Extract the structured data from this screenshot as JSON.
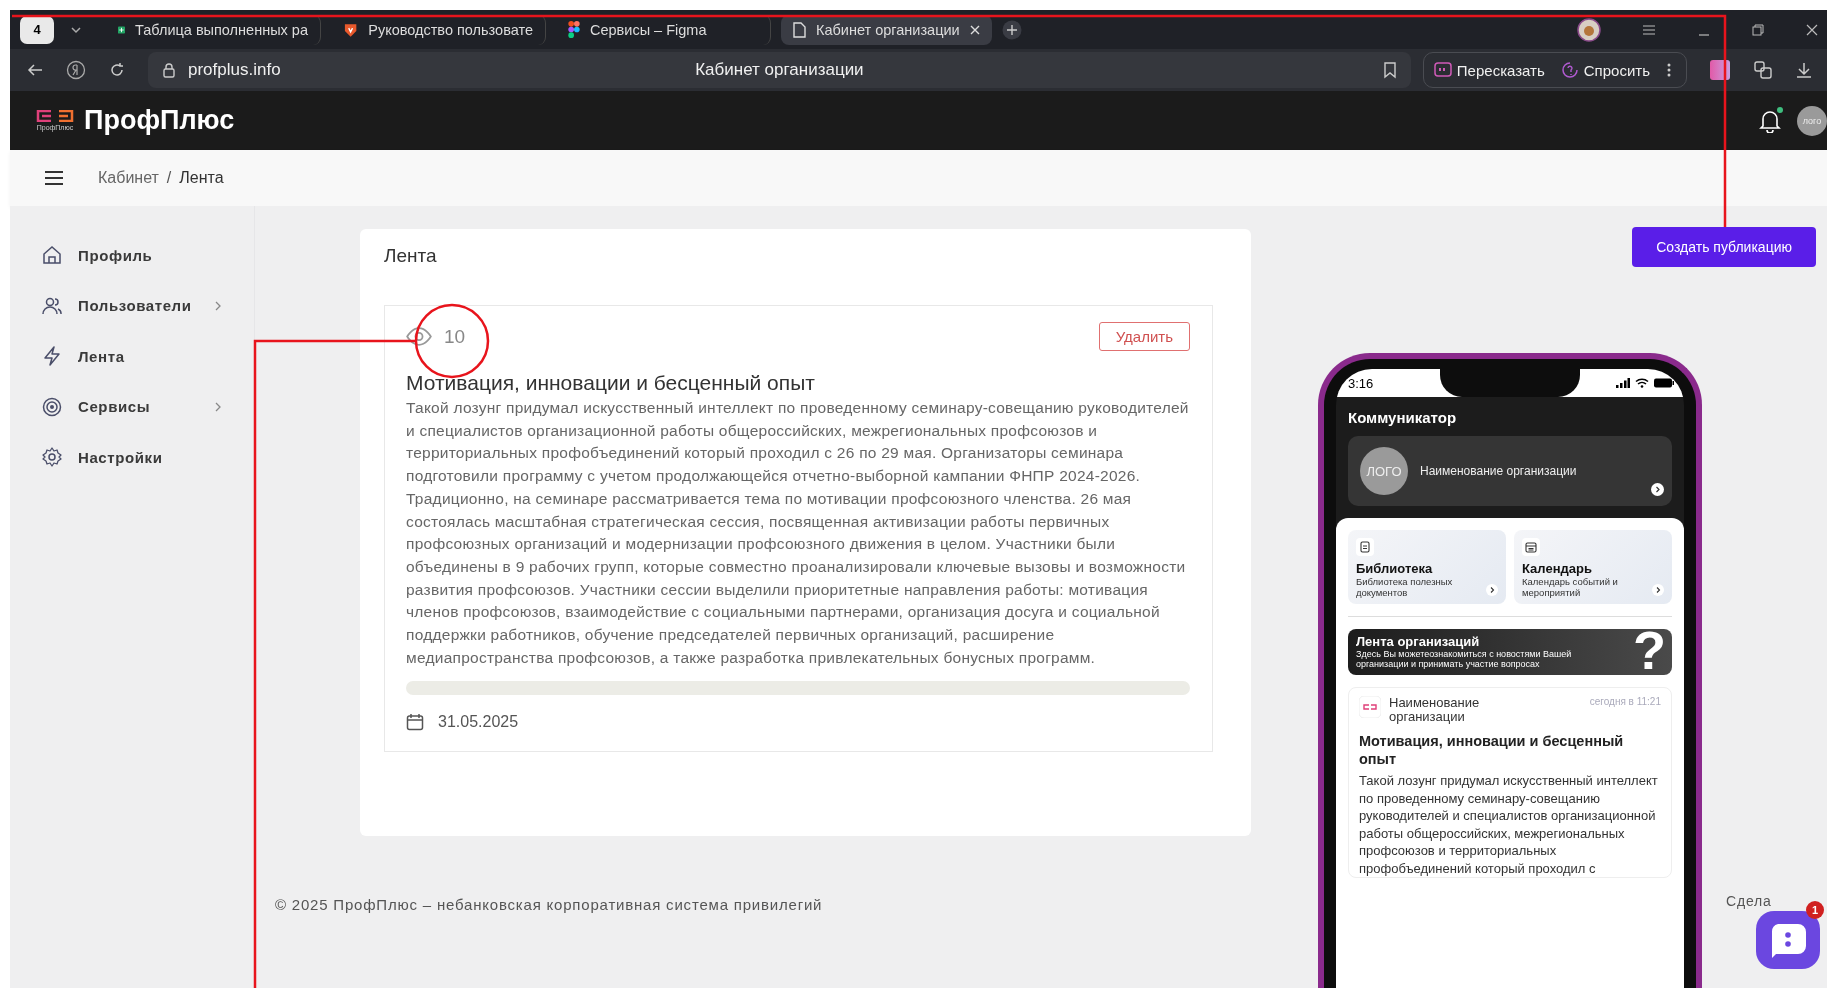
{
  "browser": {
    "tab_count": "4",
    "tabs": [
      {
        "label": "Таблица выполненных ра",
        "kind": "sheet",
        "selected": false
      },
      {
        "label": "Руководство пользовате",
        "kind": "shield",
        "selected": false
      },
      {
        "label": "Сервисы – Figma",
        "kind": "figma",
        "selected": false
      },
      {
        "label": "Кабинет организации",
        "kind": "page",
        "selected": true
      }
    ],
    "url": "profplus.info",
    "page_title": "Кабинет организации",
    "actions": [
      {
        "label": "Пересказать",
        "kind": "retell"
      },
      {
        "label": "Спросить",
        "kind": "ask"
      }
    ]
  },
  "header": {
    "logo": "ПрофПлюс",
    "logo_caption": "ПрофПлюс",
    "avatar": "лого",
    "has_notification": true
  },
  "breadcrumb": {
    "parent": "Кабинет",
    "separator": "/",
    "current": "Лента"
  },
  "sidebar": {
    "items": [
      {
        "label": "Профиль",
        "kind": "home",
        "has_submenu": false
      },
      {
        "label": "Пользователи",
        "kind": "users",
        "has_submenu": true
      },
      {
        "label": "Лента",
        "kind": "bolt",
        "has_submenu": false
      },
      {
        "label": "Сервисы",
        "kind": "target",
        "has_submenu": true
      },
      {
        "label": "Настройки",
        "kind": "gear",
        "has_submenu": false
      }
    ]
  },
  "feed": {
    "title": "Лента",
    "create_button": "Создать публикацию",
    "post": {
      "views": "10",
      "delete_button": "Удалить",
      "title": "Мотивация, инновации и бесценный опыт",
      "body": "Такой лозунг придумал искусственный интеллект по проведенному семинару-совещанию руководителей и специалистов организационной работы общероссийских, межрегиональных профсоюзов и территориальных профобъединений который проходил с 26 по 29 мая. Организаторы семинара подготовили программу с учетом продолжающейся отчетно-выборной кампании ФНПР 2024-2026. Традиционно, на семинаре рассматривается тема по мотивации профсоюзного членства. 26 мая состоялась масштабная стратегическая сессия, посвященная активизации работы первичных профсоюзных организаций и модернизации профсоюзного движения в целом. Участники были объединены в 9 рабочих групп, которые совместно проанализировали ключевые вызовы и возможности развития профсоюзов. Участники сессии выделили приоритетные направления работы: мотивация членов профсоюзов, взаимодействие с социальными партнерами, организация досуга и социальной поддержки работников, обучение председателей первичных организаций, расширение медиапространства профсоюзов, а также разработка привлекательных бонусных программ.",
      "date": "31.05.2025"
    }
  },
  "phone": {
    "time": "3:16",
    "app_title": "Коммуникатор",
    "org": {
      "logo": "ЛОГО",
      "name": "Наименование организации"
    },
    "tiles": [
      {
        "title": "Библиотека",
        "subtitle": "Библиотека полезных документов",
        "kind": "document"
      },
      {
        "title": "Календарь",
        "subtitle": "Календарь событий и мероприятий",
        "kind": "calendar"
      }
    ],
    "banner": {
      "title": "Лента организаций",
      "text": "Здесь Вы можетеознакомиться с новостями Вашей организации и принимать участие вопросах",
      "decoration": "?"
    },
    "post": {
      "org_name": "Наименование организации",
      "time": "сегодня в 11:21",
      "title": "Мотивация, инновации и бесценный опыт",
      "body": "Такой лозунг придумал искусственный интеллект по проведенному семинару-совещанию руководителей и специалистов организационной работы общероссийских, межрегиональных профсоюзов и территориальных профобъединений который проходил с"
    }
  },
  "footer": {
    "copyright": "© 2025 ПрофПлюс – небанковская корпоративная система привилегий",
    "made_with": "Сдела"
  },
  "chat": {
    "badge": "1"
  }
}
